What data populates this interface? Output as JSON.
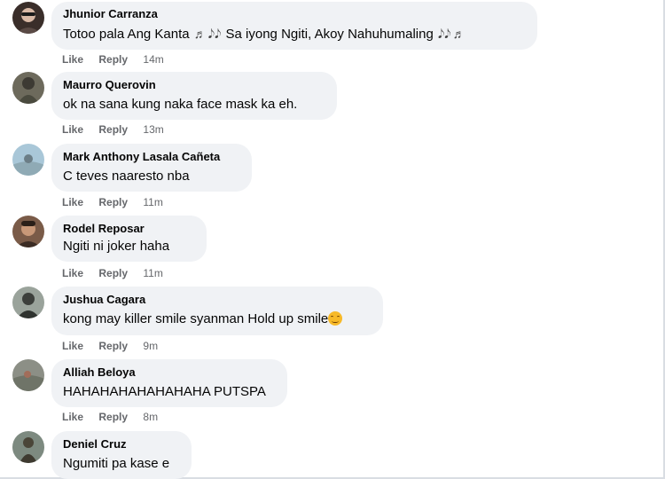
{
  "comments": [
    {
      "author": "Jhunior Carranza",
      "text_before": "Totoo pala Ang Kanta ",
      "text_mid": " Sa iyong Ngiti, Akoy Nahuhumaling ",
      "like_label": "Like",
      "reply_label": "Reply",
      "time": "14m"
    },
    {
      "author": "Maurro Querovin",
      "text": "ok na sana kung naka face mask ka eh.",
      "like_label": "Like",
      "reply_label": "Reply",
      "time": "13m"
    },
    {
      "author": "Mark Anthony Lasala Cañeta",
      "text": "C teves naaresto nba",
      "like_label": "Like",
      "reply_label": "Reply",
      "time": "11m"
    },
    {
      "author": "Rodel Reposar",
      "text": "Ngiti ni joker haha",
      "like_label": "Like",
      "reply_label": "Reply",
      "time": "11m"
    },
    {
      "author": "Jushua Cagara",
      "text": "kong may killer smile syanman Hold up smile",
      "like_label": "Like",
      "reply_label": "Reply",
      "time": "9m"
    },
    {
      "author": "Alliah Beloya",
      "text": "HAHAHAHAHAHAHAHA PUTSPA",
      "like_label": "Like",
      "reply_label": "Reply",
      "time": "8m"
    },
    {
      "author": "Deniel Cruz",
      "text": "Ngumiti pa kase e"
    }
  ],
  "icons": {
    "music_note_single": "♬",
    "music_notes_pair": "𝅘𝅥𝅮𝅘𝅥𝅮",
    "smile_emoji": "smiling-face-emoji"
  },
  "colors": {
    "bubble_bg": "#f0f2f5",
    "meta_text": "#65676b",
    "body_text": "#050505"
  }
}
